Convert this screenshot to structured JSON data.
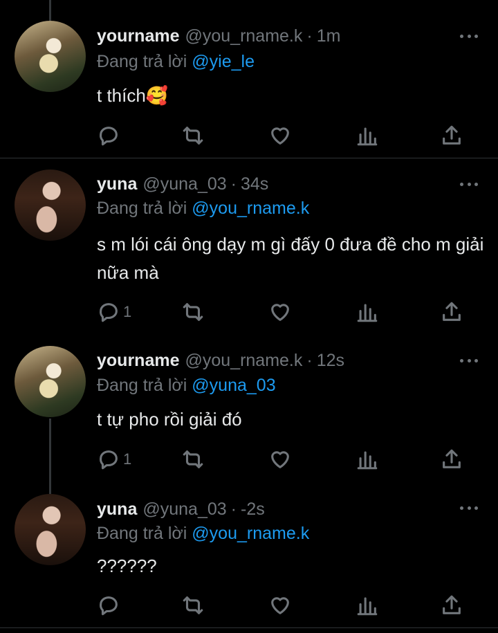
{
  "tweets": [
    {
      "name": "yourname",
      "handle": "@you_rname.k",
      "time": "1m",
      "replying_prefix": "Đang trả lời",
      "replying_to": "@yie_le",
      "text": "t thích🥰",
      "reply_count": "",
      "avatar": "avatar-a"
    },
    {
      "name": "yuna",
      "handle": "@yuna_03",
      "time": "34s",
      "replying_prefix": "Đang trả lời",
      "replying_to": "@you_rname.k",
      "text": "s m lói cái ông dạy m gì đấy 0 đưa  đề cho m giải nữa mà",
      "reply_count": "1",
      "avatar": "avatar-b"
    },
    {
      "name": "yourname",
      "handle": "@you_rname.k",
      "time": "12s",
      "replying_prefix": "Đang trả lời",
      "replying_to": "@yuna_03",
      "text": "t tự pho rồi giải đó",
      "reply_count": "1",
      "avatar": "avatar-a"
    },
    {
      "name": "yuna",
      "handle": "@yuna_03",
      "time": "-2s",
      "replying_prefix": "Đang trả lời",
      "replying_to": "@you_rname.k",
      "text": "??????",
      "reply_count": "",
      "avatar": "avatar-b"
    }
  ],
  "separator": "·",
  "icons": [
    "reply-icon",
    "retweet-icon",
    "like-icon",
    "analytics-icon",
    "share-icon",
    "more-icon"
  ],
  "colors": {
    "background": "#000000",
    "text": "#e7e9ea",
    "muted": "#71767b",
    "mention": "#1d9bf0",
    "divider": "#2f3336"
  }
}
